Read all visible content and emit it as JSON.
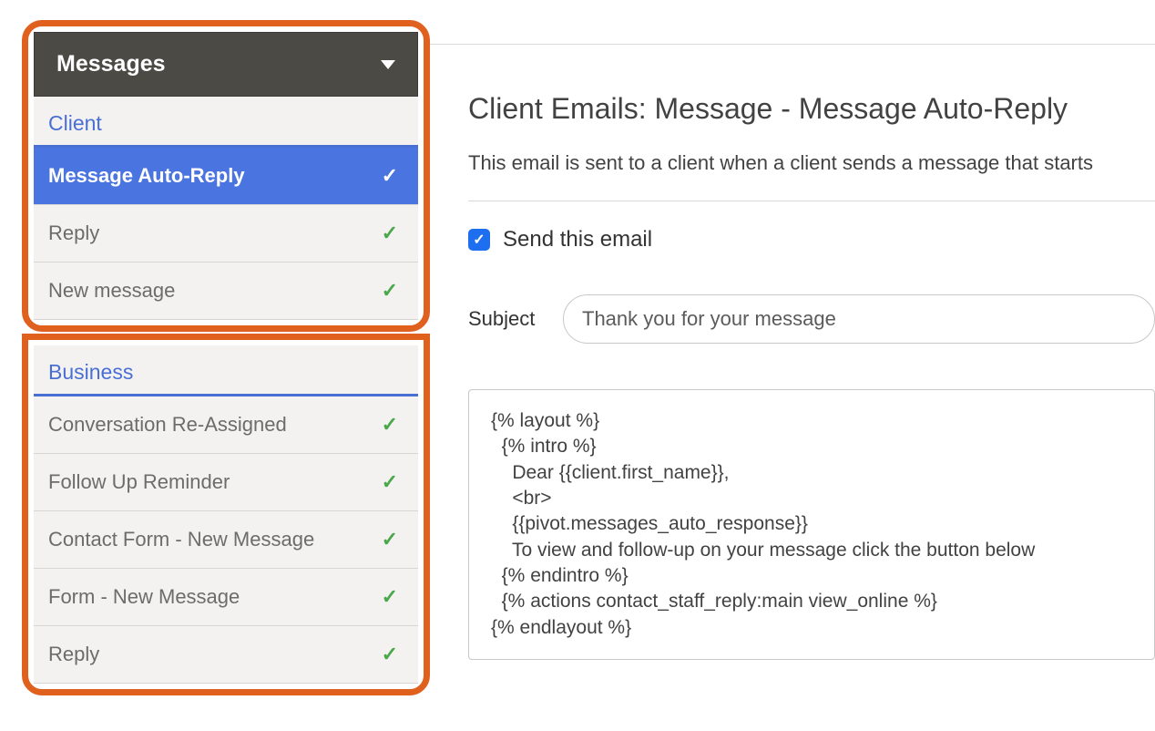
{
  "sidebar": {
    "dropdown_label": "Messages",
    "groups": [
      {
        "category": "Client",
        "items": [
          {
            "label": "Message Auto-Reply",
            "selected": true,
            "checked": true
          },
          {
            "label": "Reply",
            "selected": false,
            "checked": true
          },
          {
            "label": "New message",
            "selected": false,
            "checked": true
          }
        ]
      },
      {
        "category": "Business",
        "items": [
          {
            "label": "Conversation Re-Assigned",
            "selected": false,
            "checked": true
          },
          {
            "label": "Follow Up Reminder",
            "selected": false,
            "checked": true
          },
          {
            "label": "Contact Form - New Message",
            "selected": false,
            "checked": true
          },
          {
            "label": "Form - New Message",
            "selected": false,
            "checked": true
          },
          {
            "label": "Reply",
            "selected": false,
            "checked": true
          }
        ]
      }
    ]
  },
  "main": {
    "title": "Client Emails: Message - Message Auto-Reply",
    "description": "This email is sent to a client when a client sends a message that starts",
    "send_checkbox": {
      "checked": true,
      "label": "Send this email"
    },
    "subject": {
      "label": "Subject",
      "value": "Thank you for your message"
    },
    "body": "{% layout %}\n  {% intro %}\n    Dear {{client.first_name}},\n    <br>\n    {{pivot.messages_auto_response}}\n    To view and follow-up on your message click the button below\n  {% endintro %}\n  {% actions contact_staff_reply:main view_online %}\n{% endlayout %}"
  }
}
